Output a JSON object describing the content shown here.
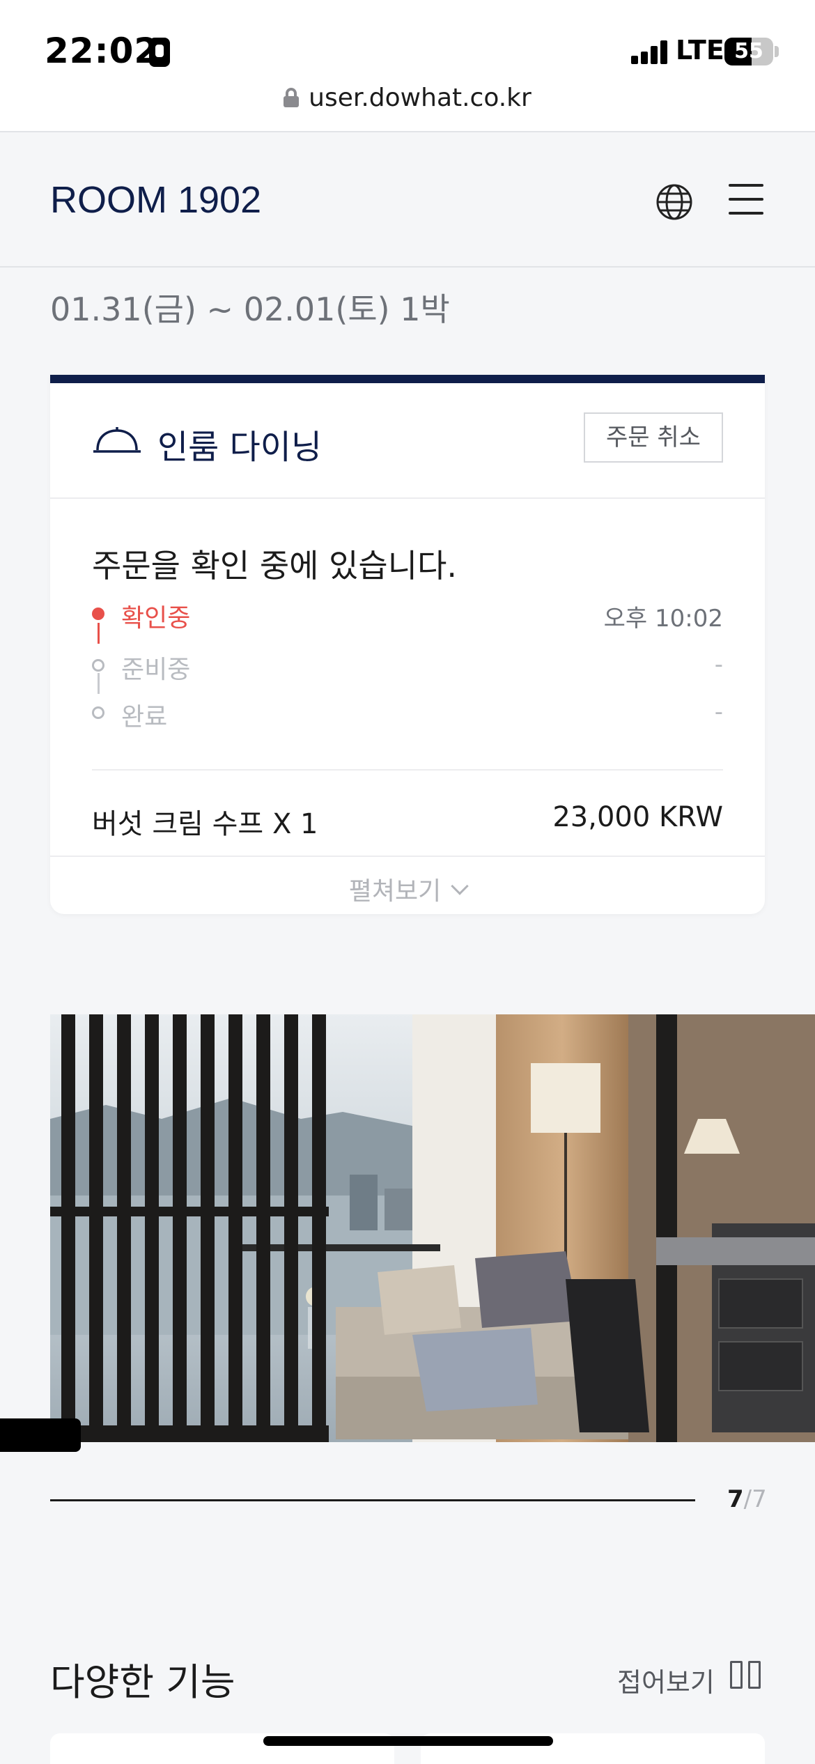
{
  "status_bar": {
    "time": "22:02",
    "network": "LTE",
    "battery": "55",
    "url": "user.dowhat.co.kr"
  },
  "header": {
    "room_title": "ROOM 1902"
  },
  "stay": {
    "dates": "01.31(금) ~ 02.01(토) 1박"
  },
  "order_card": {
    "title": "인룸 다이닝",
    "cancel_label": "주문 취소",
    "status_message": "주문을 확인 중에 있습니다.",
    "steps": [
      {
        "label": "확인중",
        "time": "오후 10:02"
      },
      {
        "label": "준비중",
        "time": "-"
      },
      {
        "label": "완료",
        "time": "-"
      }
    ],
    "item": {
      "name": "버섯 크림 수프 X 1",
      "price": "23,000 KRW"
    },
    "expand_label": "펼쳐보기"
  },
  "gallery": {
    "current": "7",
    "total": "/7",
    "progress": 1.0
  },
  "features": {
    "title": "다양한 기능",
    "collapse_label": "접어보기"
  },
  "colors": {
    "brand_navy": "#0f1e4a",
    "active_step": "#e8504a",
    "inactive_step": "#b8bbc0",
    "background": "#f5f6f8"
  },
  "icons": {
    "lock": "lock-icon",
    "globe": "globe-icon",
    "menu": "hamburger-menu-icon",
    "cloche": "room-service-cloche-icon",
    "chevron": "chevron-down-icon",
    "grid": "grid-view-icon"
  }
}
